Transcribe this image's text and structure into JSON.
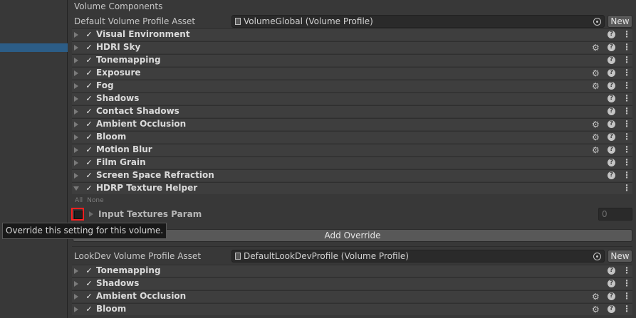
{
  "section_title": "Volume Components",
  "default_profile": {
    "label": "Default Volume Profile Asset",
    "value": "VolumeGlobal (Volume Profile)",
    "new_label": "New"
  },
  "components": [
    {
      "name": "Visual Environment",
      "gear": false
    },
    {
      "name": "HDRI Sky",
      "gear": true
    },
    {
      "name": "Tonemapping",
      "gear": false
    },
    {
      "name": "Exposure",
      "gear": true
    },
    {
      "name": "Fog",
      "gear": true
    },
    {
      "name": "Shadows",
      "gear": false
    },
    {
      "name": "Contact Shadows",
      "gear": false
    },
    {
      "name": "Ambient Occlusion",
      "gear": true
    },
    {
      "name": "Bloom",
      "gear": true
    },
    {
      "name": "Motion Blur",
      "gear": true
    },
    {
      "name": "Film Grain",
      "gear": false
    },
    {
      "name": "Screen Space Refraction",
      "gear": false
    },
    {
      "name": "HDRP Texture Helper",
      "gear": false
    }
  ],
  "toggles": {
    "all": "All",
    "none": "None"
  },
  "param": {
    "label": "Input Textures Param",
    "value": "0"
  },
  "tooltip": "Override this setting for this volume.",
  "add_override": "Add Override",
  "lookdev_profile": {
    "label": "LookDev Volume Profile Asset",
    "value": "DefaultLookDevProfile (Volume Profile)",
    "new_label": "New"
  },
  "lookdev_components": [
    {
      "name": "Tonemapping",
      "gear": false
    },
    {
      "name": "Shadows",
      "gear": false
    },
    {
      "name": "Ambient Occlusion",
      "gear": true
    },
    {
      "name": "Bloom",
      "gear": true
    }
  ],
  "colors": {
    "background": "#383838",
    "highlight": "#ff2020",
    "selection": "#2c5d87"
  }
}
